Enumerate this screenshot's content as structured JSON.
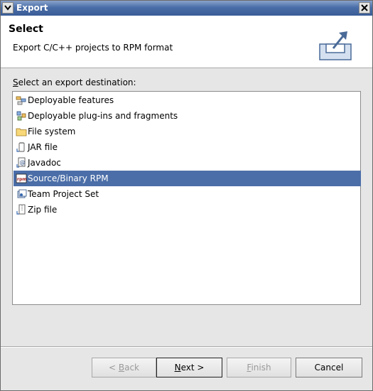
{
  "window": {
    "title": "Export"
  },
  "header": {
    "title": "Select",
    "description": "Export C/C++ projects to RPM format"
  },
  "list_label": {
    "mnemonic": "S",
    "rest": "elect an export destination:"
  },
  "items": [
    {
      "label": "Deployable features",
      "icon": "features-icon"
    },
    {
      "label": "Deployable plug-ins and fragments",
      "icon": "plugins-icon"
    },
    {
      "label": "File system",
      "icon": "folder-icon"
    },
    {
      "label": "JAR file",
      "icon": "jar-icon"
    },
    {
      "label": "Javadoc",
      "icon": "javadoc-icon"
    },
    {
      "label": "Source/Binary RPM",
      "icon": "rpm-icon",
      "selected": true
    },
    {
      "label": "Team Project Set",
      "icon": "team-icon"
    },
    {
      "label": "Zip file",
      "icon": "zip-icon"
    }
  ],
  "buttons": {
    "back_pre": "< ",
    "back_mn": "B",
    "back_post": "ack",
    "next_mn": "N",
    "next_post": "ext >",
    "finish_mn": "F",
    "finish_post": "inish",
    "cancel": "Cancel"
  },
  "colors": {
    "selection": "#4b6ea8",
    "titlebar": "#4a6ea8"
  }
}
